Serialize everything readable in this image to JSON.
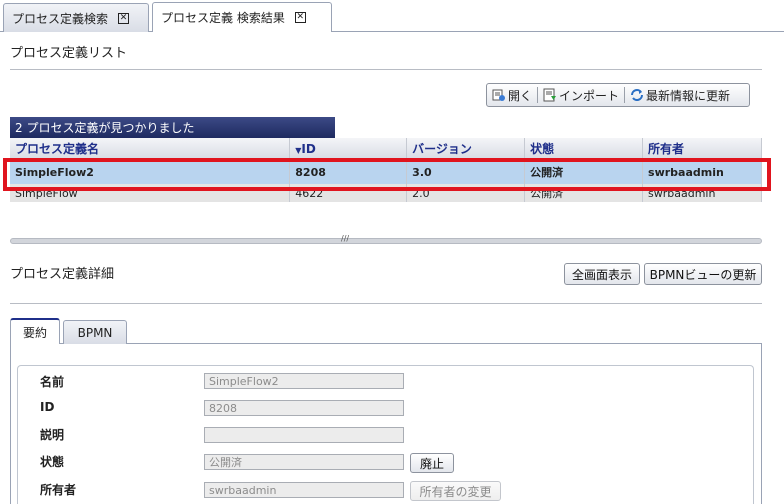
{
  "tabs": [
    {
      "label": "プロセス定義検索",
      "active": false
    },
    {
      "label": "プロセス定義 検索結果",
      "active": true
    }
  ],
  "list": {
    "title": "プロセス定義リスト",
    "toolbar": {
      "open": "開く",
      "import": "インポート",
      "refresh": "最新情報に更新"
    },
    "result_count": "2 プロセス定義が見つかりました",
    "columns": [
      "プロセス定義名",
      "ID",
      "バージョン",
      "状態",
      "所有者"
    ],
    "rows": [
      {
        "name": "SimpleFlow2",
        "id": "8208",
        "version": "3.0",
        "status": "公開済",
        "owner": "swrbaadmin"
      },
      {
        "name": "SimpleFlow",
        "id": "4622",
        "version": "2.0",
        "status": "公開済",
        "owner": "swrbaadmin"
      }
    ]
  },
  "detail": {
    "title": "プロセス定義詳細",
    "fullscreen_button": "全画面表示",
    "bpmn_refresh_button": "BPMNビューの更新",
    "tabs": [
      "要約",
      "BPMN"
    ],
    "fields": {
      "name_label": "名前",
      "name_value": "SimpleFlow2",
      "id_label": "ID",
      "id_value": "8208",
      "desc_label": "説明",
      "desc_value": "",
      "status_label": "状態",
      "status_value": "公開済",
      "owner_label": "所有者",
      "owner_value": "swrbaadmin"
    },
    "deprecate_button": "廃止",
    "change_owner_button": "所有者の変更"
  },
  "colors": {
    "accent": "#1f2f8a",
    "selection": "#b9d4ef",
    "highlight": "#e0141e"
  }
}
